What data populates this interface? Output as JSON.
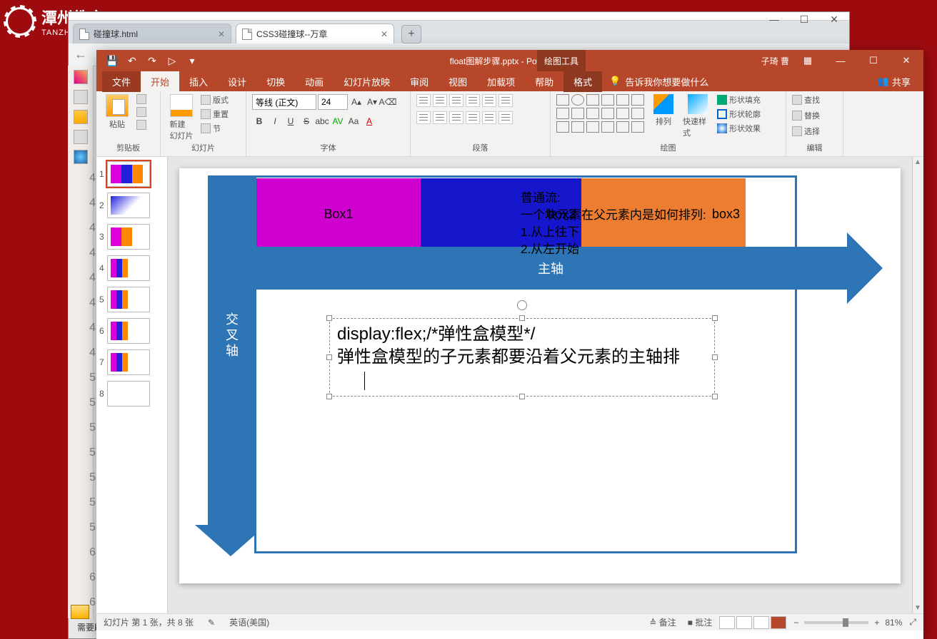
{
  "logo": {
    "cn": "潭州教育",
    "en": "TANZHOUEDU"
  },
  "browser": {
    "tabs": [
      {
        "label": "碰撞球.html"
      },
      {
        "label": "CSS3碰撞球--万章"
      }
    ],
    "controls": {
      "min": "—",
      "max": "☐",
      "close": "✕"
    }
  },
  "editor_gutter": [
    "4",
    "4",
    "4",
    "4",
    "4",
    "4",
    "4",
    "4",
    "5",
    "5",
    "5",
    "5",
    "5",
    "5",
    "5",
    "6",
    "6",
    "6"
  ],
  "bottom_note": "需要刷",
  "ppt": {
    "qat": {
      "save": "💾",
      "undo": "↶",
      "redo": "↷",
      "start": "▷",
      "more": "▾"
    },
    "title": "float图解步骤.pptx - PowerPoint",
    "context_tab": "绘图工具",
    "user": "子琦 曹",
    "win": {
      "grid": "▦",
      "min": "—",
      "max": "☐",
      "close": "✕"
    },
    "tabs": {
      "file": "文件",
      "home": "开始",
      "insert": "插入",
      "design": "设计",
      "transition": "切换",
      "animation": "动画",
      "slideshow": "幻灯片放映",
      "review": "审阅",
      "view": "视图",
      "addins": "加载项",
      "help": "帮助",
      "format": "格式",
      "tell": "告诉我你想要做什么",
      "share": "共享"
    },
    "ribbon": {
      "clipboard": {
        "paste": "粘贴",
        "cut": "剪切",
        "copy": "复制",
        "fmt": "格式刷",
        "label": "剪贴板"
      },
      "slides": {
        "new": "新建\n幻灯片",
        "layout": "版式",
        "reset": "重置",
        "section": "节",
        "label": "幻灯片"
      },
      "font": {
        "name": "等线 (正文)",
        "size": "24",
        "label": "字体"
      },
      "paragraph": {
        "label": "段落"
      },
      "drawing": {
        "arrange": "排列",
        "quick": "快速样式",
        "fill": "形状填充",
        "outline": "形状轮廓",
        "effects": "形状效果",
        "label": "绘图"
      },
      "editing": {
        "find": "查找",
        "replace": "替换",
        "select": "选择",
        "label": "编辑"
      }
    },
    "thumbnails": [
      "1",
      "2",
      "3",
      "4",
      "5",
      "6",
      "7",
      "8"
    ],
    "slide": {
      "cross_axis": "交叉轴",
      "main_axis": "主轴",
      "box1": "Box1",
      "box2": "box2",
      "box3": "box3",
      "note_line1": "普通流:",
      "note_line2": "一个块元素在父元素内是如何排列:",
      "note_line3": "1.从上往下",
      "note_line4": "2.从左开始",
      "edit_line1": "display:flex;/*弹性盒模型*/",
      "edit_line2": "弹性盒模型的子元素都要沿着父元素的主轴排"
    },
    "status": {
      "slide_info": "幻灯片 第 1 张，共 8 张",
      "lang_ico": "✎",
      "lang": "英语(美国)",
      "notes": "≙ 备注",
      "comments": "■ 批注",
      "zoom": "81%",
      "fit": "⤢"
    }
  }
}
